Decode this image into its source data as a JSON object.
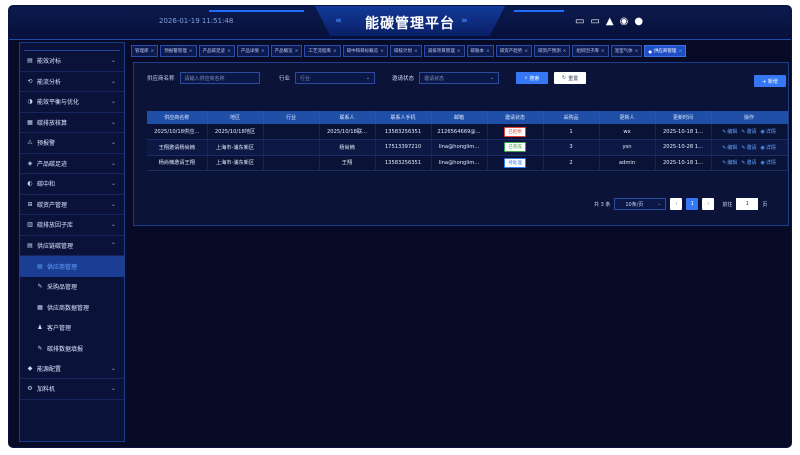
{
  "header": {
    "datetime": "2026-01-19 11:51:48",
    "title": "能碳管理平台",
    "chev_left": "‹‹‹",
    "chev_right": "›››",
    "icons": [
      "screen-icon",
      "monitor-icon",
      "bell-icon",
      "user-badge-icon",
      "avatar-icon"
    ]
  },
  "sidebar": {
    "items": [
      {
        "label": "能效对标",
        "icon": "▤",
        "arrow": "⌄"
      },
      {
        "label": "能流分析",
        "icon": "⟲",
        "arrow": "⌄"
      },
      {
        "label": "能效平衡与优化",
        "icon": "◑",
        "arrow": "⌄"
      },
      {
        "label": "碳排放核算",
        "icon": "▦",
        "arrow": "⌄"
      },
      {
        "label": "预报警",
        "icon": "⚠",
        "arrow": "⌄"
      },
      {
        "label": "产品碳足迹",
        "icon": "◈",
        "arrow": "⌄"
      },
      {
        "label": "碳中和",
        "icon": "◐",
        "arrow": "⌄"
      },
      {
        "label": "碳资产管理",
        "icon": "⊞",
        "arrow": "⌄"
      },
      {
        "label": "碳排放因子库",
        "icon": "▥",
        "arrow": "⌄"
      },
      {
        "label": "供应链碳管理",
        "icon": "▤",
        "arrow": "⌃"
      }
    ],
    "sub_items": [
      {
        "label": "供应商管理",
        "icon": "▤"
      },
      {
        "label": "采购品管理",
        "icon": "✎"
      },
      {
        "label": "供应商数据管理",
        "icon": "▦"
      },
      {
        "label": "客户管理",
        "icon": "♟"
      },
      {
        "label": "碳排数据填报",
        "icon": "✎"
      }
    ],
    "bottom_items": [
      {
        "label": "能源配置",
        "icon": "◆",
        "arrow": "⌄"
      },
      {
        "label": "加料机",
        "icon": "⚙",
        "arrow": "⌄"
      }
    ]
  },
  "tabs": [
    {
      "label": "管理库",
      "close": "×"
    },
    {
      "label": "预报警管理",
      "close": "×"
    },
    {
      "label": "产品碳足迹",
      "close": "×"
    },
    {
      "label": "产品详情",
      "close": "×"
    },
    {
      "label": "产品概览",
      "close": "×"
    },
    {
      "label": "工艺流程库",
      "close": "×"
    },
    {
      "label": "碳中和目标概览",
      "close": "×"
    },
    {
      "label": "碳核计划",
      "close": "×"
    },
    {
      "label": "减排项目管理",
      "close": "×"
    },
    {
      "label": "碳账本",
      "close": "×"
    },
    {
      "label": "碳资产趋势",
      "close": "×"
    },
    {
      "label": "碳资产预测",
      "close": "×"
    },
    {
      "label": "组织因子库",
      "close": "×"
    },
    {
      "label": "温室气体",
      "close": "×"
    },
    {
      "label": "供应商管理",
      "close": "×",
      "active": true
    }
  ],
  "filters": {
    "name_label": "供应商名称",
    "name_placeholder": "请输入供应商名称",
    "industry_label": "行业",
    "industry_placeholder": "行业",
    "status_label": "邀请状态",
    "status_placeholder": "邀请状态",
    "search_label": "搜索",
    "reset_label": "重置",
    "add_label": "+ 新增"
  },
  "table": {
    "columns": [
      "供应商名称",
      "地区",
      "行业",
      "联系人",
      "联系人手机",
      "邮箱",
      "邀请状态",
      "采购品",
      "更新人",
      "更新时间",
      "操作"
    ],
    "rows": [
      {
        "name": "2025/10/18供应...",
        "region": "2025/10/18地区",
        "industry": "",
        "contact": "2025/10/18联...",
        "phone": "13583256351",
        "email": "2126564669@...",
        "status": "已拒绝",
        "status_color": "#e0443a",
        "purchases": "1",
        "updater": "wx",
        "time": "2025-10-18 1..."
      },
      {
        "name": "王翔邀请杨尚楠",
        "region": "上海市-浦东新区",
        "industry": "",
        "contact": "杨尚楠",
        "phone": "17513397210",
        "email": "lina@honglim...",
        "status": "已完成",
        "status_color": "#3aa34a",
        "purchases": "3",
        "updater": "ysn",
        "time": "2025-10-28 1..."
      },
      {
        "name": "杨尚楠邀请王翔",
        "region": "上海市-浦东新区",
        "industry": "",
        "contact": "王翔",
        "phone": "13583256351",
        "email": "lina@honglim...",
        "status": "待处理",
        "status_color": "#3478f6",
        "purchases": "2",
        "updater": "admin",
        "time": "2025-10-18 1..."
      }
    ],
    "ops": {
      "edit": "编辑",
      "invite": "邀请",
      "detail": "详情"
    }
  },
  "pager": {
    "total": "共 3 条",
    "page_size": "10条/页",
    "prev": "‹",
    "current": "1",
    "next": "›",
    "goto_label": "前往",
    "goto_value": "1",
    "page_unit": "页"
  }
}
